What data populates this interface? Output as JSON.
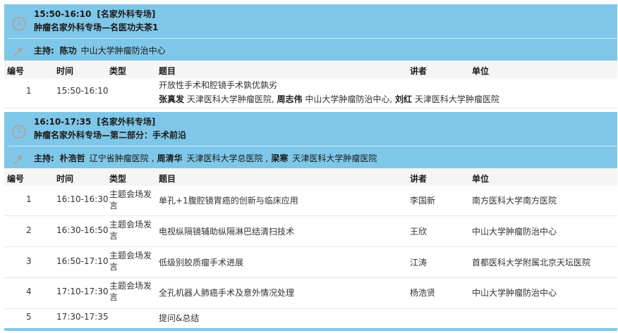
{
  "headers": {
    "no": "编号",
    "time": "时间",
    "type": "类型",
    "topic": "题目",
    "speaker": "讲者",
    "unit": "单位"
  },
  "host_label": "主持:",
  "sessions": [
    {
      "time": "15:50-16:10",
      "tag": "[名家外科专场]",
      "name": "肿瘤名家外科专场—名医功夫茶1",
      "hosts": [
        {
          "name": "陈功",
          "unit": "中山大学肿瘤防治中心"
        }
      ],
      "rows": [
        {
          "no": "1",
          "time": "15:50-16:10",
          "type": "",
          "topic": "开放性手术和腔镜手术孰优孰劣",
          "discussants": [
            {
              "name": "张真发",
              "unit": "天津医科大学肿瘤医院"
            },
            {
              "name": "周志伟",
              "unit": "中山大学肿瘤防治中心"
            },
            {
              "name": "刘红",
              "unit": "天津医科大学肿瘤医院"
            }
          ],
          "speaker": "",
          "unit": ""
        }
      ]
    },
    {
      "time": "16:10-17:35",
      "tag": "[名家外科专场]",
      "name": "肿瘤名家外科专场—第二部分：手术前沿",
      "hosts": [
        {
          "name": "朴浩哲",
          "unit": "辽宁省肿瘤医院"
        },
        {
          "name": "周清华",
          "unit": "天津医科大学总医院"
        },
        {
          "name": "梁寒",
          "unit": "天津医科大学肿瘤医院"
        }
      ],
      "rows": [
        {
          "no": "1",
          "time": "16:10-16:30",
          "type": "主题会场发言",
          "topic": "单孔+1腹腔镜胃癌的创新与临床应用",
          "speaker": "李国新",
          "unit": "南方医科大学南方医院"
        },
        {
          "no": "2",
          "time": "16:30-16:50",
          "type": "主题会场发言",
          "topic": "电视纵隔镜辅助纵隔淋巴结清扫技术",
          "speaker": "王欣",
          "unit": "中山大学肿瘤防治中心"
        },
        {
          "no": "3",
          "time": "16:50-17:10",
          "type": "主题会场发言",
          "topic": "低级别胶质瘤手术进展",
          "speaker": "江涛",
          "unit": "首都医科大学附属北京天坛医院"
        },
        {
          "no": "4",
          "time": "17:10-17:30",
          "type": "主题会场发言",
          "topic": "全孔机器人肺癌手术及意外情况处理",
          "speaker": "杨浩贤",
          "unit": "中山大学肿瘤防治中心"
        },
        {
          "no": "5",
          "time": "17:30-17:35",
          "type": "",
          "topic": "提问&总结",
          "speaker": "",
          "unit": ""
        }
      ]
    }
  ]
}
